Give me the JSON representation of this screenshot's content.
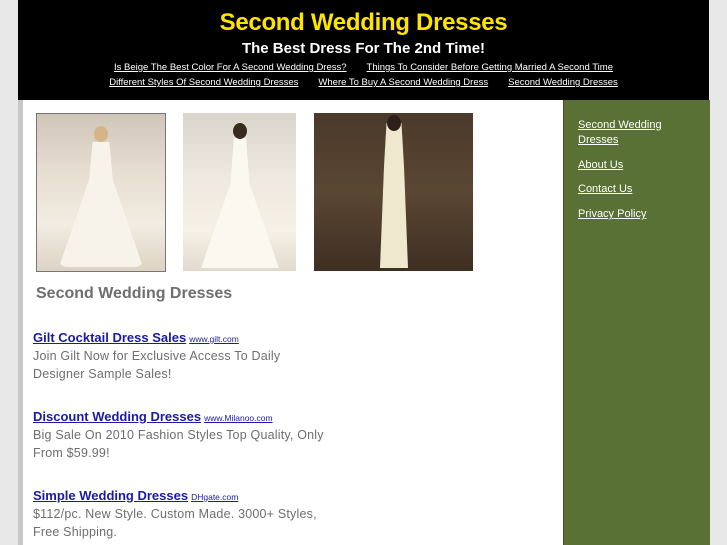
{
  "header": {
    "title": "Second Wedding Dresses",
    "tagline": "The Best Dress For The 2nd Time!",
    "nav_row1": [
      "Is Beige The Best Color For A Second Wedding Dress?",
      "Things To Consider Before Getting Married A Second Time"
    ],
    "nav_row2": [
      "Different Styles Of Second Wedding Dresses",
      "Where To Buy A Second Wedding Dress",
      "Second Wedding Dresses"
    ]
  },
  "main": {
    "heading": "Second Wedding Dresses",
    "ads": [
      {
        "title": "Gilt Cocktail Dress Sales",
        "url": "www.gilt.com",
        "desc1": "Join Gilt Now for Exclusive Access To Daily",
        "desc2": "Designer Sample Sales!"
      },
      {
        "title": "Discount Wedding Dresses",
        "url": "www.Milanoo.com",
        "desc1": "Big Sale On 2010 Fashion Styles Top Quality, Only",
        "desc2": "From $59.99!"
      },
      {
        "title": "Simple Wedding Dresses",
        "url": "DHgate.com",
        "desc1": "$112/pc. New Style. Custom Made. 3000+ Styles,",
        "desc2": "Free Shipping."
      }
    ]
  },
  "sidebar": {
    "links": [
      "Second Wedding Dresses",
      "About Us",
      "Contact Us",
      "Privacy Policy"
    ]
  },
  "colors": {
    "title": "#ffe400",
    "header_bg": "#000000",
    "sidebar_bg": "#5a7135",
    "ad_link": "#1a1aa6"
  }
}
